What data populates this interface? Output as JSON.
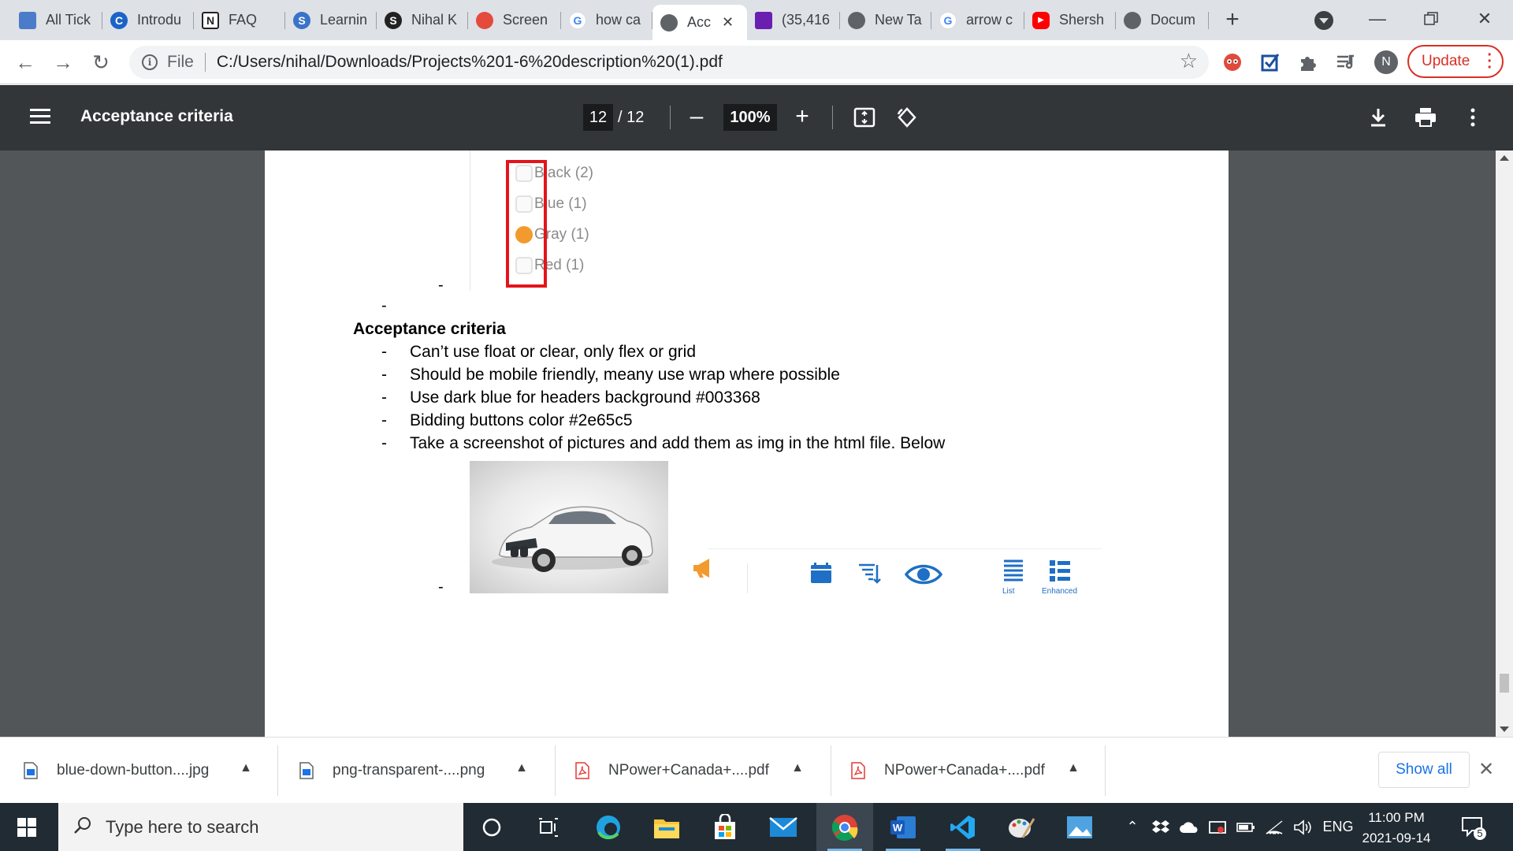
{
  "browser": {
    "tabs": [
      {
        "label": "All Tick",
        "favicon": "doc-icon",
        "color": "#4a7cc9"
      },
      {
        "label": "Introdu",
        "favicon": "c-logo-icon",
        "color": "#1a63c8"
      },
      {
        "label": "FAQ",
        "favicon": "notion-icon",
        "color": "#222222"
      },
      {
        "label": "Learnin",
        "favicon": "s-logo-icon",
        "color": "#3a73c8"
      },
      {
        "label": "Nihal K",
        "favicon": "s-logo-icon",
        "color": "#222222"
      },
      {
        "label": "Screen",
        "favicon": "rainbow-icon",
        "color": "#e44b3c"
      },
      {
        "label": "how ca",
        "favicon": "google-icon",
        "color": "#4285f4"
      },
      {
        "label": "Acc",
        "favicon": "globe-icon",
        "color": "#5f6368",
        "active": true
      },
      {
        "label": "(35,416",
        "favicon": "mail-icon",
        "color": "#6b1fb1"
      },
      {
        "label": "New Ta",
        "favicon": "globe-icon",
        "color": "#5f6368"
      },
      {
        "label": "arrow c",
        "favicon": "google-icon",
        "color": "#4285f4"
      },
      {
        "label": "Shersh",
        "favicon": "youtube-icon",
        "color": "#ff0000"
      },
      {
        "label": "Docum",
        "favicon": "globe-icon",
        "color": "#5f6368"
      }
    ],
    "new_tab_label": "+",
    "address": {
      "scheme": "File",
      "url": "C:/Users/nihal/Downloads/Projects%201-6%20description%20(1).pdf"
    },
    "profile_initial": "N",
    "update_label": "Update"
  },
  "pdf_toolbar": {
    "title": "Acceptance criteria",
    "current_page": "12",
    "page_total": "/ 12",
    "zoom": "100%"
  },
  "document": {
    "filter_options": [
      {
        "label": "Black (2)",
        "checked": false
      },
      {
        "label": "Blue (1)",
        "checked": false
      },
      {
        "label": "Gray (1)",
        "checked": true
      },
      {
        "label": "Red (1)",
        "checked": false
      }
    ],
    "dash": "-",
    "heading": "Acceptance criteria",
    "criteria": [
      "Can’t use float or clear, only flex or grid",
      "Should be mobile friendly, meany use wrap where possible",
      "Use dark blue for headers background #003368",
      "Bidding buttons color #2e65c5",
      "Take a screenshot of pictures and add them as img in the html file. Below"
    ],
    "icon_labels": [
      "List",
      "Enhanced"
    ],
    "accent_orange": "#f39a2e",
    "highlight_red": "#e3141b",
    "icon_blue": "#1e6fc5"
  },
  "downloads": {
    "items": [
      {
        "name": "blue-down-button....jpg",
        "type": "image"
      },
      {
        "name": "png-transparent-....png",
        "type": "image"
      },
      {
        "name": "NPower+Canada+....pdf",
        "type": "pdf"
      },
      {
        "name": "NPower+Canada+....pdf",
        "type": "pdf"
      }
    ],
    "show_all": "Show all"
  },
  "taskbar": {
    "search_placeholder": "Type here to search",
    "language": "ENG",
    "time": "11:00 PM",
    "date": "2021-09-14",
    "notification_count": "5"
  }
}
